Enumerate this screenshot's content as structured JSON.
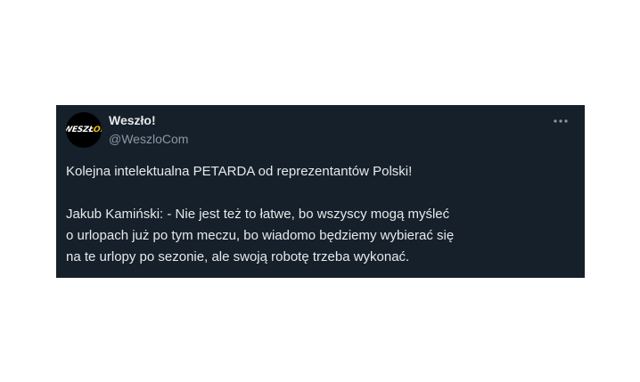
{
  "tweet": {
    "author": {
      "display_name": "Weszło!",
      "handle": "@WeszloCom",
      "avatar_text_main": "WESZŁ",
      "avatar_text_accent": "O!"
    },
    "more_icon": "more-horizontal-icon",
    "text": {
      "line1": "Kolejna intelektualna PETARDA od reprezentantów Polski!",
      "line2": "Jakub Kamiński: - Nie jest też to łatwe, bo wszyscy mogą myśleć",
      "line3": "o urlopach już po tym meczu, bo wiadomo będziemy wybierać się",
      "line4": "na te urlopy po sezonie, ale swoją robotę trzeba wykonać."
    },
    "colors": {
      "background": "#15202b",
      "text": "#e7e9ea",
      "secondary": "#8b98a5",
      "accent": "#f2c200"
    }
  }
}
